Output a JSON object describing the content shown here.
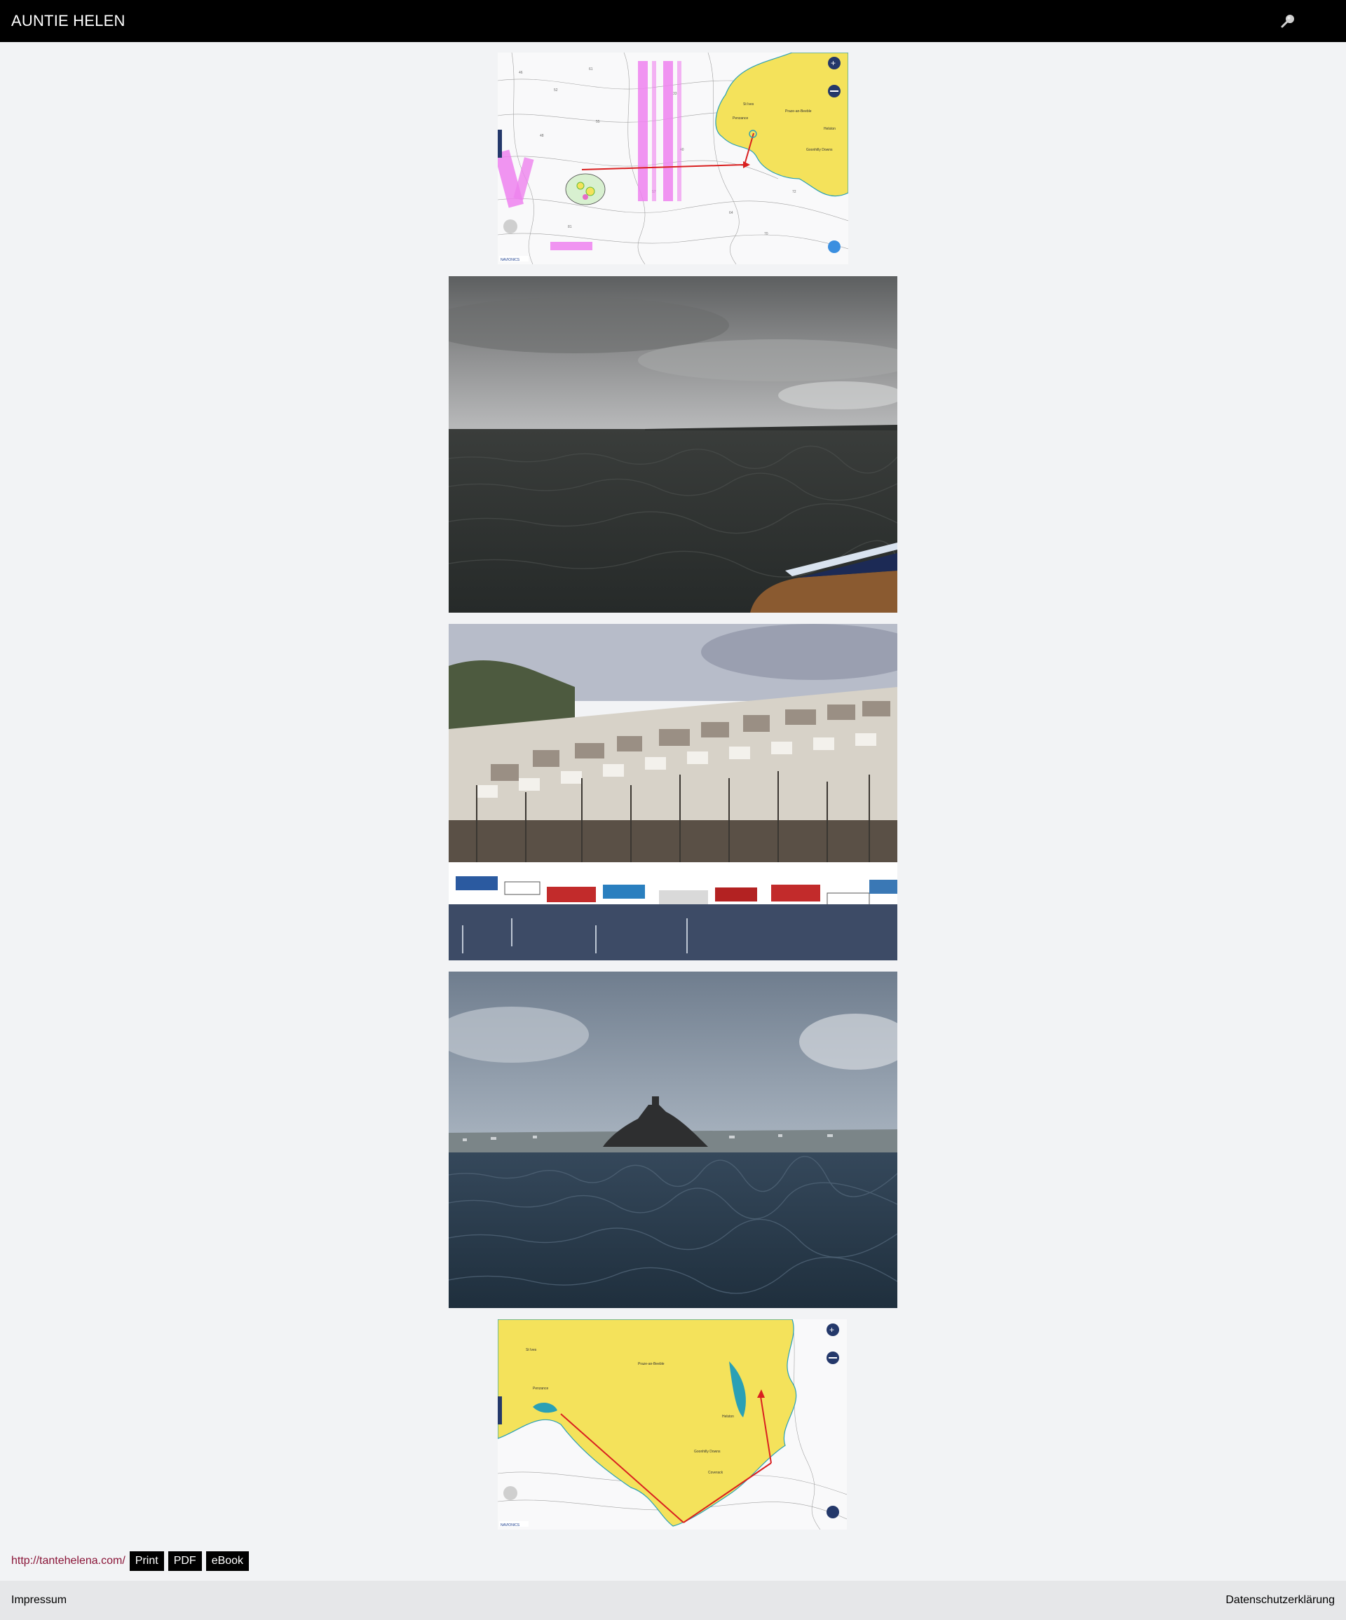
{
  "header": {
    "site_title": "AUNTIE HELEN",
    "search_icon": "magnifier-icon"
  },
  "main": {
    "images": [
      {
        "kind": "chart-map",
        "alt": "Navionics map route to Penzance"
      },
      {
        "kind": "photo",
        "alt": "Grey sea under clouds with land on horizon"
      },
      {
        "kind": "photo",
        "alt": "Harbour with fishing boats and hillside houses"
      },
      {
        "kind": "photo",
        "alt": "St Michael's Mount across choppy sea"
      },
      {
        "kind": "chart-map",
        "alt": "Navionics map route around Lizard to Falmouth"
      }
    ]
  },
  "footer": {
    "site_url": "http://tantehelena.com/",
    "print_label": "Print",
    "pdf_label": "PDF",
    "ebook_label": "eBook",
    "imprint_label": "Impressum",
    "privacy_label": "Datenschutzerklärung"
  },
  "colors": {
    "header_bg": "#000000",
    "link_color": "#8a1538",
    "page_bg": "#f2f3f5",
    "map_land": "#f4e25b",
    "map_route": "#d92020"
  }
}
